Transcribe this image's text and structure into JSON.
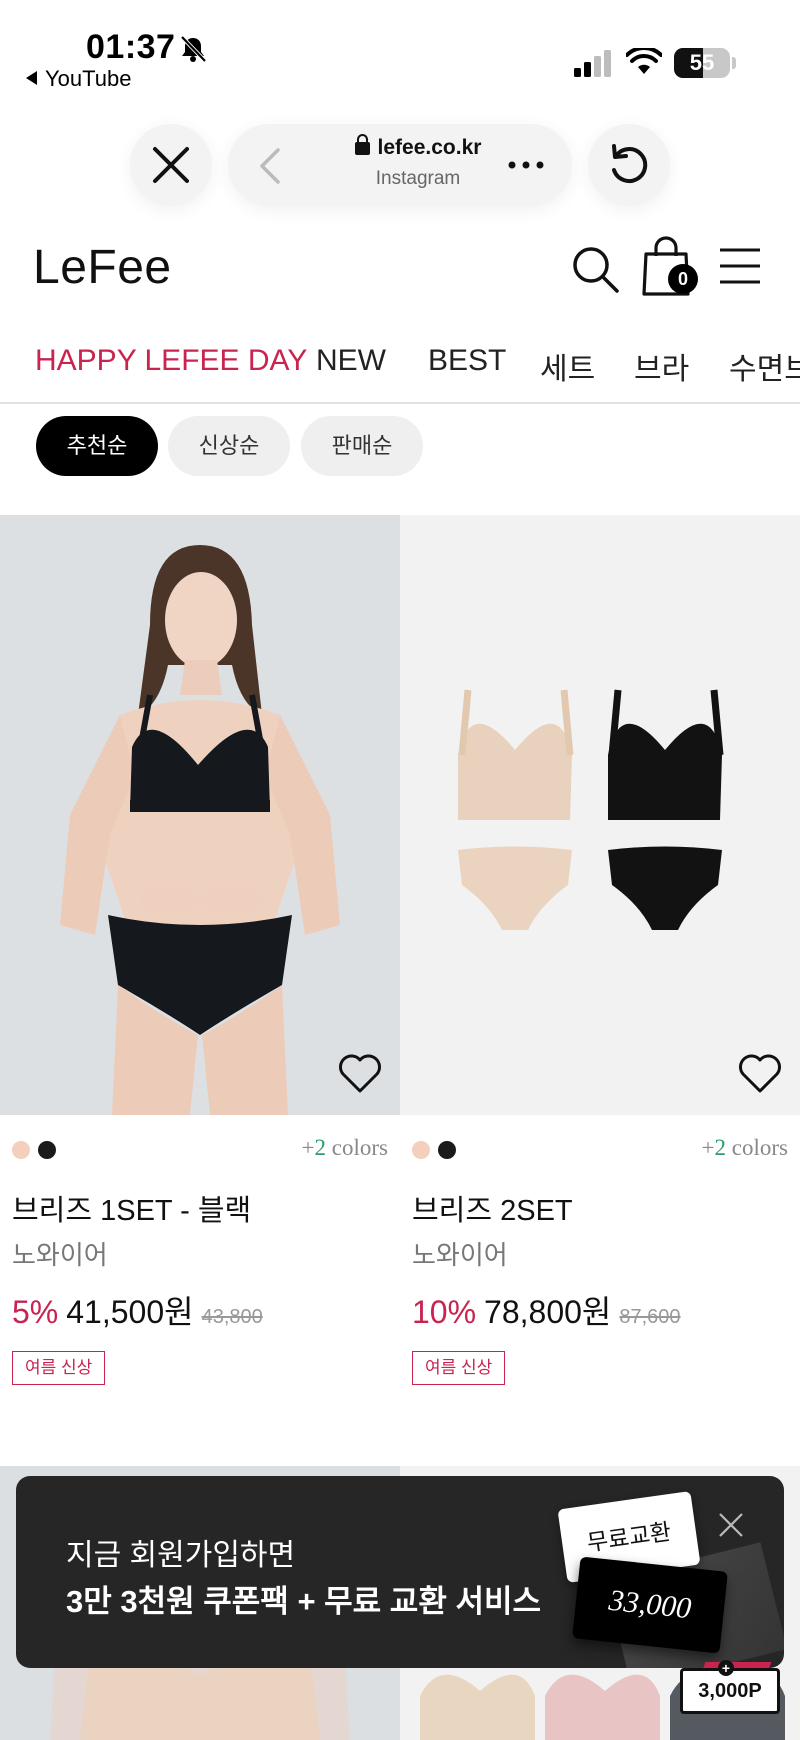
{
  "status_bar": {
    "time": "01:37",
    "back_app": "YouTube",
    "battery": "55"
  },
  "browser": {
    "domain": "lefee.co.kr",
    "source": "Instagram"
  },
  "header": {
    "logo": "LeFee",
    "cart_count": "0"
  },
  "category_nav": [
    {
      "label": "HAPPY LEFEE DAY",
      "active": true
    },
    {
      "label": "NEW",
      "active": false
    },
    {
      "label": "BEST",
      "active": false
    },
    {
      "label": "세트",
      "active": false
    },
    {
      "label": "브라",
      "active": false
    },
    {
      "label": "수면브",
      "active": false
    }
  ],
  "sort_chips": [
    {
      "label": "추천순",
      "active": true
    },
    {
      "label": "신상순",
      "active": false
    },
    {
      "label": "판매순",
      "active": false
    }
  ],
  "products": [
    {
      "swatch_colors": [
        "#f4cfbd",
        "#1a1a1a"
      ],
      "colors_prefix": "+",
      "colors_count": "2",
      "colors_suffix": " colors",
      "name": "브리즈 1SET - 블랙",
      "brand": "노와이어",
      "discount": "5%",
      "price": "41,500원",
      "original_price": "43,800",
      "tag": "여름 신상"
    },
    {
      "swatch_colors": [
        "#f4cfbd",
        "#1a1a1a"
      ],
      "colors_prefix": "+",
      "colors_count": "2",
      "colors_suffix": " colors",
      "name": "브리즈 2SET",
      "brand": "노와이어",
      "discount": "10%",
      "price": "78,800원",
      "original_price": "87,600",
      "tag": "여름 신상"
    }
  ],
  "promo": {
    "line1": "지금 회원가입하면",
    "line2": "3만 3천원 쿠폰팩 + 무료 교환 서비스",
    "ticket_label": "무료교환",
    "coupon_amount": "33,000"
  },
  "point_badge": "3,000P",
  "colors": {
    "accent": "#c8244f",
    "colors_count": "#2a9d6a",
    "banner_bg": "#262626"
  }
}
